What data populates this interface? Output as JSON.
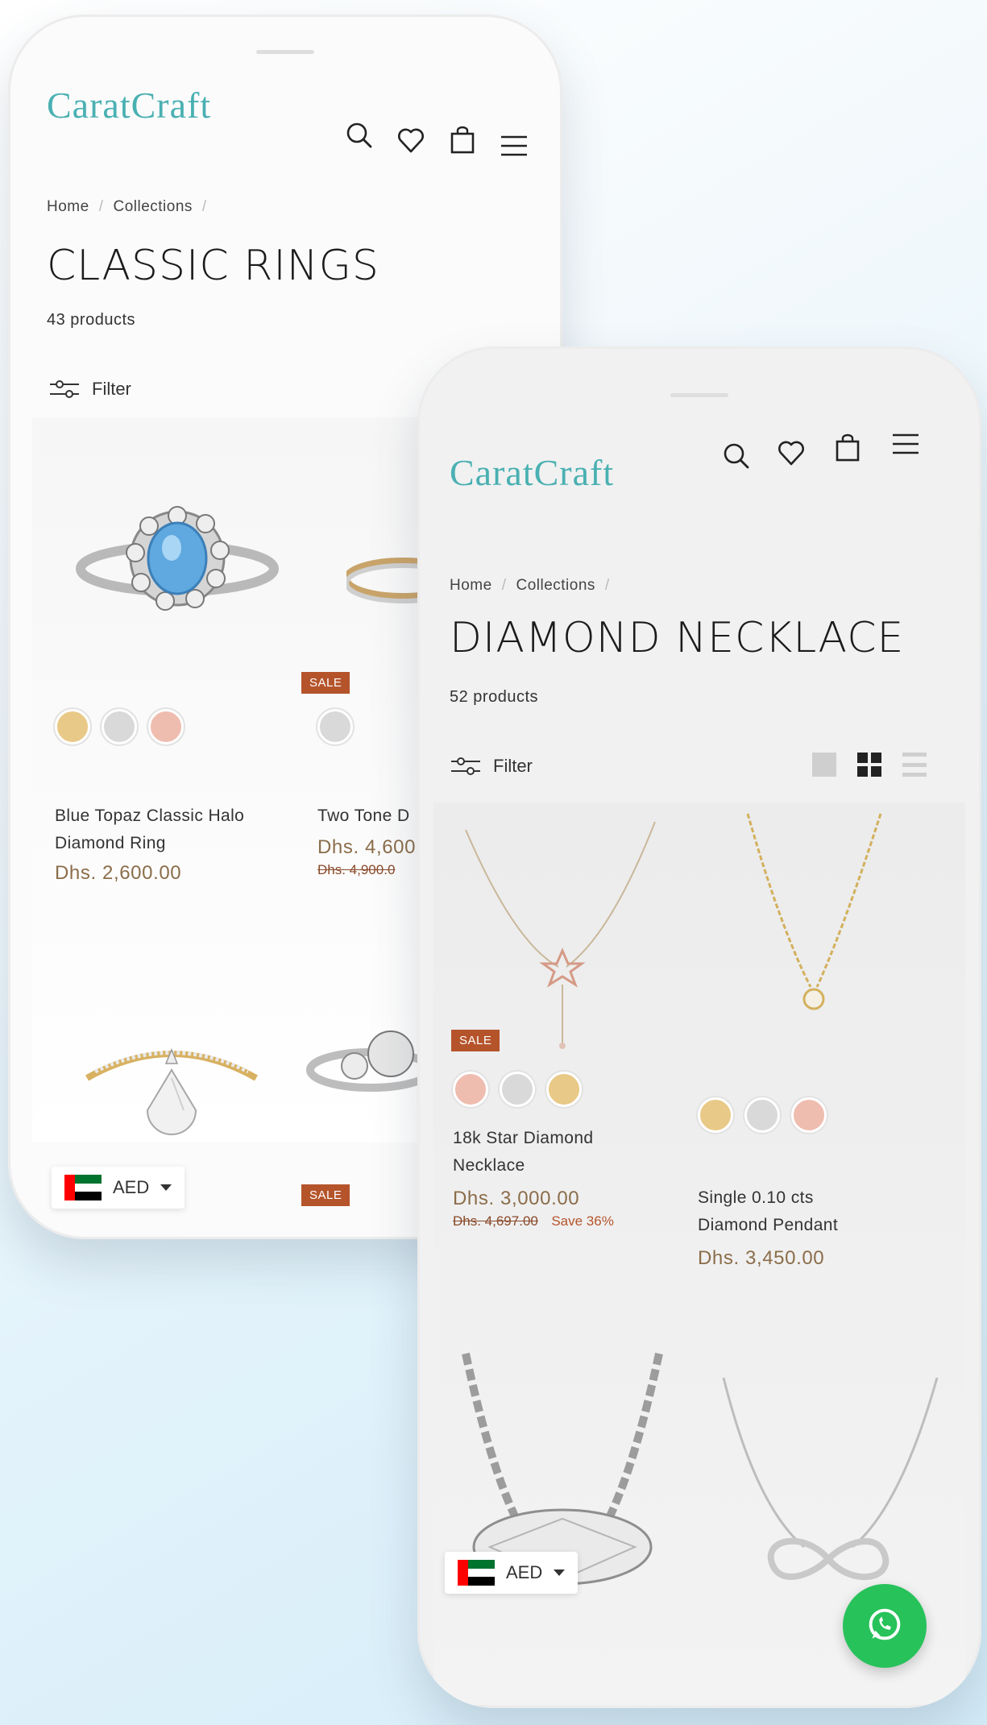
{
  "brand": {
    "logo": "CaratCraft",
    "accent": "#4ab0b2"
  },
  "back_screen": {
    "breadcrumb": [
      "Home",
      "Collections"
    ],
    "title": "CLASSIC RINGS",
    "count": "43 products",
    "filter_label": "Filter",
    "products": [
      {
        "name_line1": "Blue Topaz Classic Halo",
        "name_line2": "Diamond Ring",
        "price": "Dhs. 2,600.00",
        "swatches": [
          "#e9c987",
          "#d9d9d9",
          "#efbdb0"
        ]
      },
      {
        "name_line1": "Two Tone D",
        "price": "Dhs. 4,600",
        "old_price": "Dhs. 4,900.0",
        "sale": "SALE",
        "swatches": [
          "#d9d9d9"
        ]
      }
    ],
    "sale_badge_2": "SALE",
    "currency": "AED"
  },
  "front_screen": {
    "breadcrumb": [
      "Home",
      "Collections"
    ],
    "title": "DIAMOND NECKLACE",
    "count": "52 products",
    "filter_label": "Filter",
    "products": [
      {
        "name_line1": "18k Star Diamond",
        "name_line2": "Necklace",
        "price": "Dhs. 3,000.00",
        "old_price": "Dhs. 4,697.00",
        "save": "Save 36%",
        "sale": "SALE",
        "swatches": [
          "#efbdb0",
          "#d9d9d9",
          "#e9c987"
        ]
      },
      {
        "name_line1": "Single 0.10 cts",
        "name_line2": "Diamond Pendant",
        "price": "Dhs. 3,450.00",
        "swatches": [
          "#e9c987",
          "#d9d9d9",
          "#efbdb0"
        ]
      }
    ],
    "currency": "AED"
  },
  "icons": [
    "search-icon",
    "heart-icon",
    "bag-icon",
    "menu-icon",
    "filter-icon",
    "grid-view-icon",
    "whatsapp-icon",
    "uae-flag-icon"
  ]
}
